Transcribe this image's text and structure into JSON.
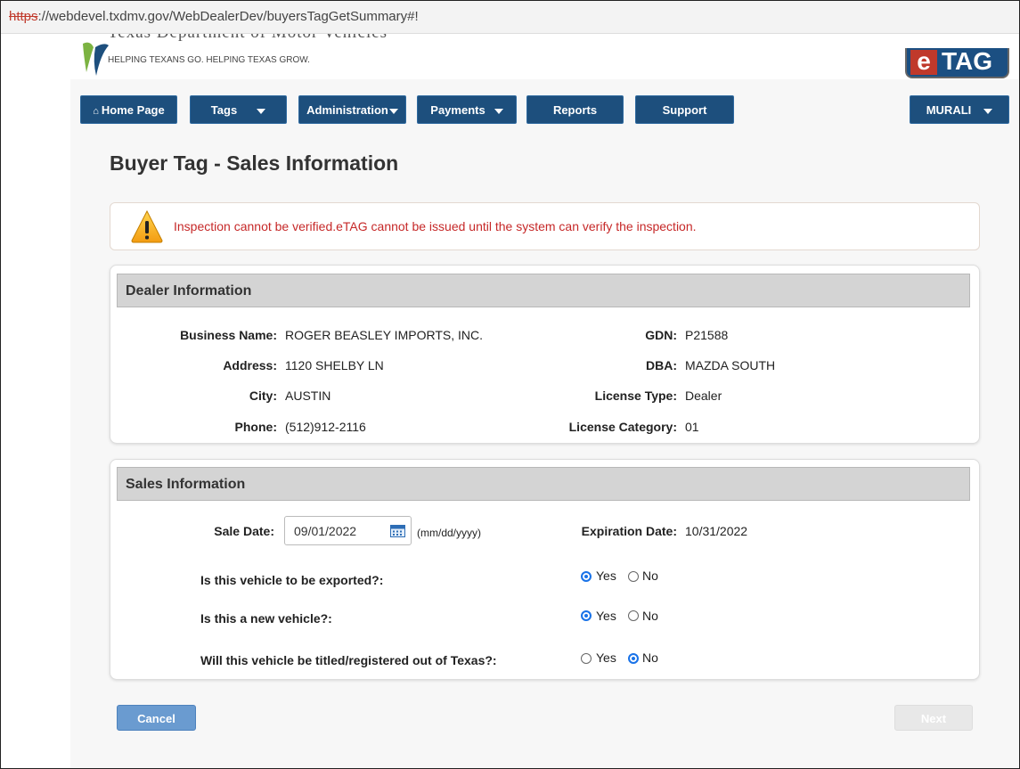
{
  "browser": {
    "url_protocol": "https",
    "url_rest": "://webdevel.txdmv.gov/WebDealerDev/buyersTagGetSummary#!"
  },
  "header": {
    "agency_name": "Texas Department of Motor Vehicles",
    "tagline": "HELPING TEXANS GO. HELPING TEXAS GROW.",
    "etag_e": "e",
    "etag_rest": "TAG"
  },
  "nav": {
    "home": "Home Page",
    "home_icon": "home-icon",
    "tags": "Tags",
    "administration": "Administration",
    "payments": "Payments",
    "reports": "Reports",
    "support": "Support",
    "user": "MURALI"
  },
  "page": {
    "title": "Buyer Tag - Sales Information"
  },
  "alert": {
    "message": "Inspection cannot be verified.eTAG cannot be issued until the system can verify the inspection."
  },
  "dealer": {
    "heading": "Dealer Information",
    "business_name_label": "Business Name:",
    "business_name": "ROGER BEASLEY IMPORTS, INC.",
    "address_label": "Address:",
    "address": "1120 SHELBY LN",
    "city_label": "City:",
    "city": "AUSTIN",
    "phone_label": "Phone:",
    "phone": "(512)912-2116",
    "gdn_label": "GDN:",
    "gdn": "P21588",
    "dba_label": "DBA:",
    "dba": "MAZDA SOUTH",
    "license_type_label": "License Type:",
    "license_type": "Dealer",
    "license_category_label": "License Category:",
    "license_category": "01"
  },
  "sales": {
    "heading": "Sales Information",
    "sale_date_label": "Sale Date:",
    "sale_date": "09/01/2022",
    "date_format": "(mm/dd/yyyy)",
    "expiration_label": "Expiration Date:",
    "expiration_date": "10/31/2022",
    "yes_label": "Yes",
    "no_label": "No",
    "questions": [
      {
        "text": "Is this vehicle to be exported?:",
        "answer": "Yes"
      },
      {
        "text": "Is this a new vehicle?:",
        "answer": "Yes"
      },
      {
        "text": "Will this vehicle be titled/registered out of Texas?:",
        "answer": "No"
      }
    ]
  },
  "buttons": {
    "cancel": "Cancel",
    "next": "Next"
  },
  "colors": {
    "nav_blue": "#1d4f7d",
    "alert_red": "#c62828",
    "radio_blue": "#1a73e8",
    "cancel_blue": "#6a9bd0"
  }
}
